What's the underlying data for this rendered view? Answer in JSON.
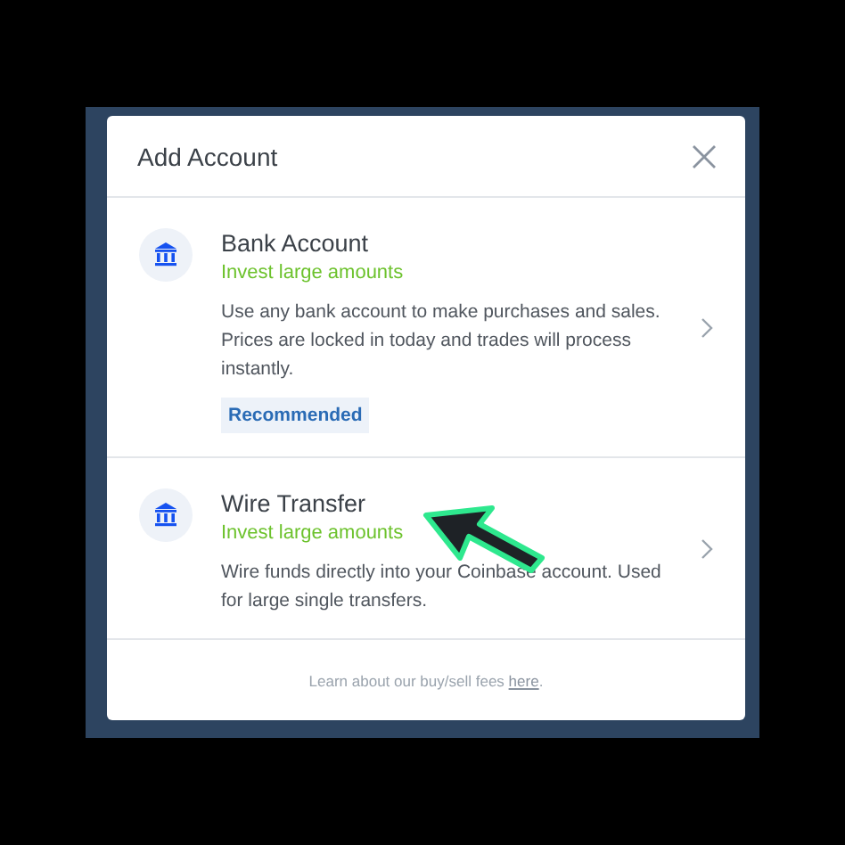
{
  "dialog": {
    "title": "Add Account"
  },
  "options": [
    {
      "title": "Bank Account",
      "subtitle": "Invest large amounts",
      "description": "Use any bank account to make purchases and sales. Prices are locked in today and trades will process instantly.",
      "badge": "Recommended"
    },
    {
      "title": "Wire Transfer",
      "subtitle": "Invest large amounts",
      "description": "Wire funds directly into your Coinbase account. Used for large single transfers."
    }
  ],
  "footer": {
    "text": "Learn about our buy/sell fees ",
    "link": "here",
    "end": "."
  }
}
